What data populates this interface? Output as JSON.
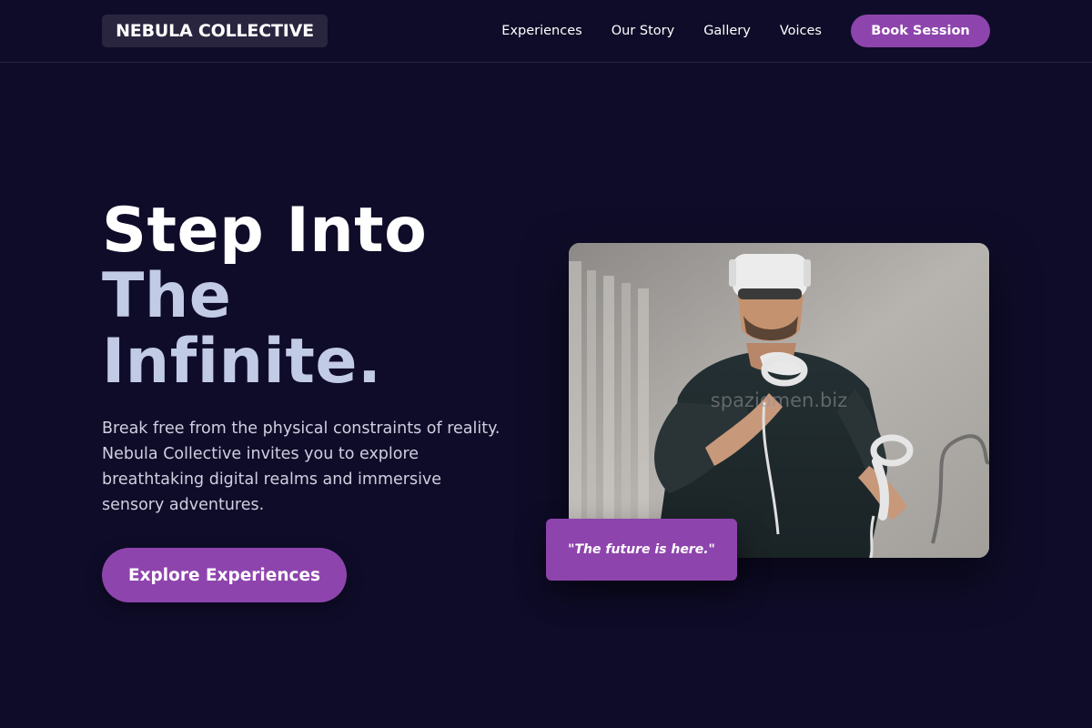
{
  "header": {
    "logo": "NEBULA COLLECTIVE",
    "nav": [
      {
        "label": "Experiences"
      },
      {
        "label": "Our Story"
      },
      {
        "label": "Gallery"
      },
      {
        "label": "Voices"
      }
    ],
    "cta": "Book Session"
  },
  "hero": {
    "title_line_1": "Step Into",
    "title_line_2": "The",
    "title_line_3": "Infinite.",
    "description": "Break free from the physical constraints of reality. Nebula Collective invites you to explore breathtaking digital realms and immersive sensory adventures.",
    "cta": "Explore Experiences",
    "watermark": "spaziomen.biz",
    "quote": "\"The future is here.\""
  },
  "colors": {
    "background": "#0f0c29",
    "accent": "#8e44ad",
    "title_highlight": "#c2cbe6"
  },
  "icons": {
    "photo": "person-wearing-vr-headset-photo"
  }
}
